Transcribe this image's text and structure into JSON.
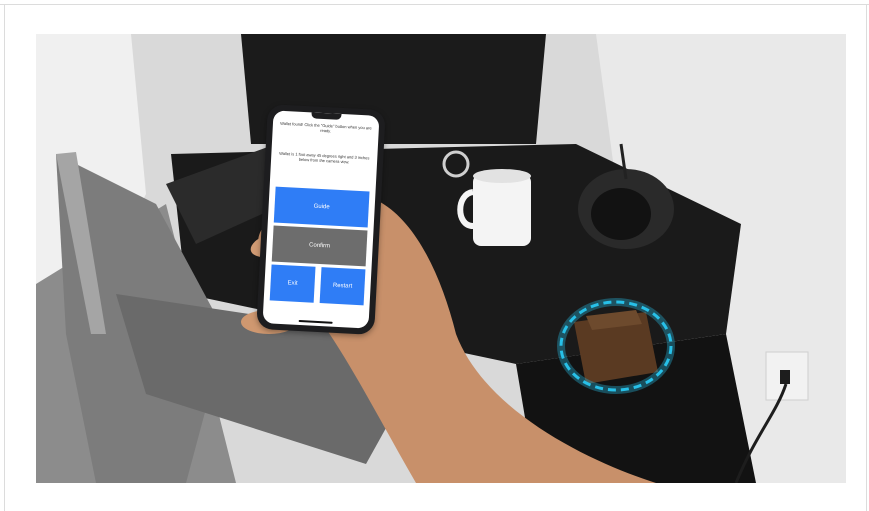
{
  "phone_app": {
    "message_top": "Wallet found! Click the \"Guide\" button when you are ready.",
    "message_instruction": "Wallet is 1 foot away 45 degrees right and 3 inches below from the camera view.",
    "guide_label": "Guide",
    "confirm_label": "Confirm",
    "exit_label": "Exit",
    "restart_label": "Restart"
  },
  "colors": {
    "primary_button": "#2f7df6",
    "secondary_button": "#6d6d6d",
    "highlight_ring": "#27c0e8"
  },
  "icons": [
    "wallet-highlight-ring"
  ]
}
